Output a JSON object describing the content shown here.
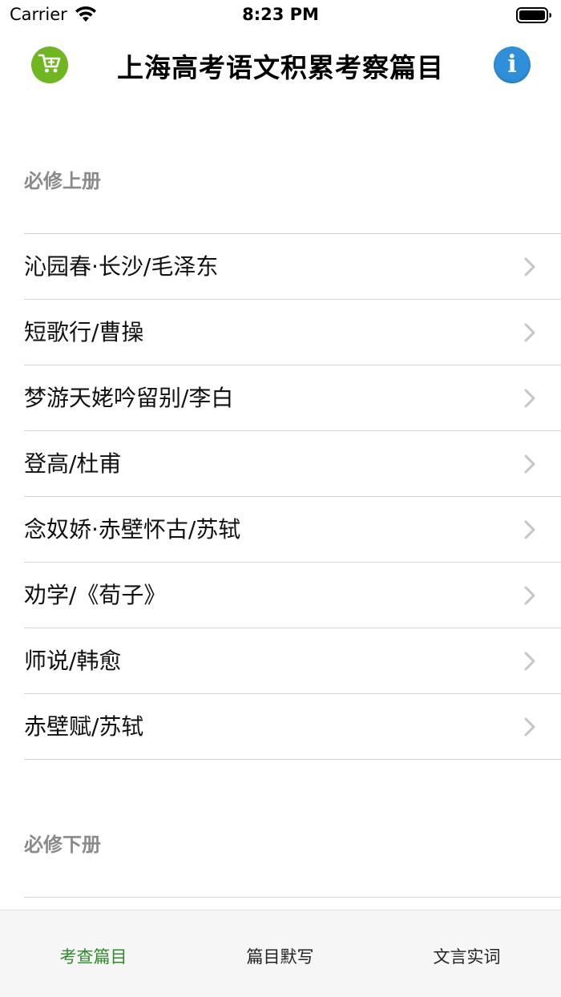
{
  "status_bar": {
    "carrier": "Carrier",
    "time": "8:23 PM"
  },
  "nav": {
    "title": "上海高考语文积累考察篇目",
    "info_letter": "i",
    "cart_color": "#6fb620",
    "info_color": "#2f8fd8"
  },
  "sections": [
    {
      "title": "必修上册",
      "items": [
        "沁园春·长沙/毛泽东",
        "短歌行/曹操",
        "梦游天姥吟留别/李白",
        "登高/杜甫",
        "念奴娇·赤壁怀古/苏轼",
        "劝学/《荀子》",
        "师说/韩愈",
        "赤壁赋/苏轼"
      ]
    },
    {
      "title": "必修下册",
      "items": []
    }
  ],
  "tabs": [
    {
      "label": "考查篇目",
      "active": true
    },
    {
      "label": "篇目默写",
      "active": false
    },
    {
      "label": "文言实词",
      "active": false
    }
  ],
  "colors": {
    "tab_active": "#2f8a2a",
    "section_header": "#8a8a8a",
    "chevron": "#c4c4c9"
  }
}
